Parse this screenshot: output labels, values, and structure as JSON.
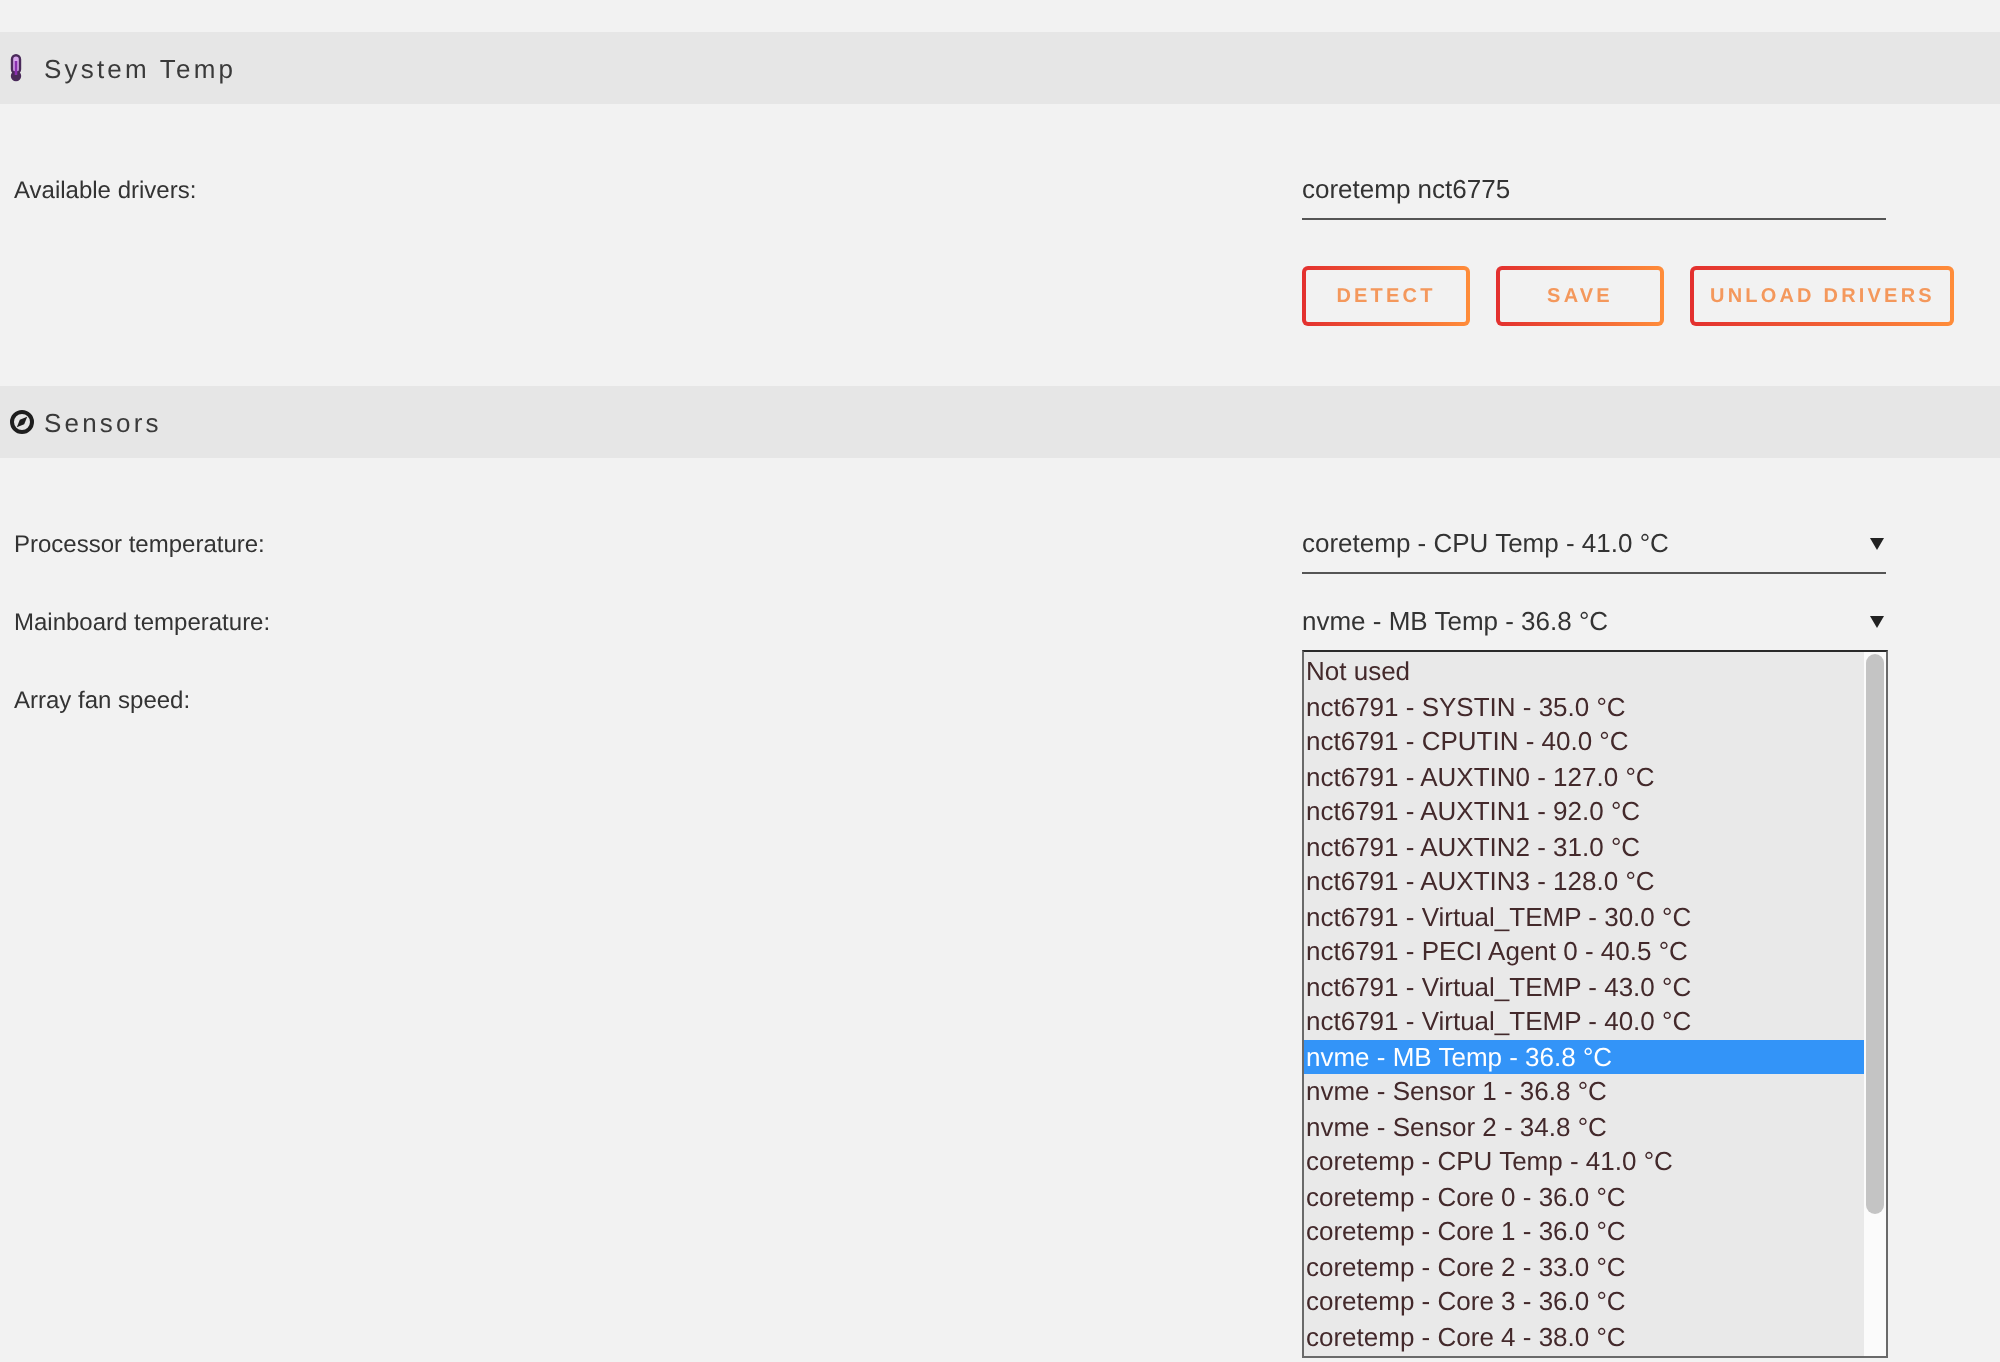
{
  "system_temp": {
    "title": "System Temp",
    "drivers": {
      "label": "Available drivers:",
      "value": "coretemp nct6775"
    },
    "buttons": [
      "DETECT",
      "SAVE",
      "UNLOAD DRIVERS"
    ]
  },
  "sensors": {
    "title": "Sensors",
    "rows": [
      {
        "label": "Processor temperature:",
        "value": "coretemp - CPU Temp - 41.0 °C",
        "expanded": false
      },
      {
        "label": "Mainboard temperature:",
        "value": "nvme - MB Temp - 36.8 °C",
        "expanded": true,
        "options": [
          {
            "label": "Not used",
            "selected": false
          },
          {
            "label": "nct6791 - SYSTIN - 35.0 °C",
            "selected": false
          },
          {
            "label": "nct6791 - CPUTIN - 40.0 °C",
            "selected": false
          },
          {
            "label": "nct6791 - AUXTIN0 - 127.0 °C",
            "selected": false
          },
          {
            "label": "nct6791 - AUXTIN1 - 92.0 °C",
            "selected": false
          },
          {
            "label": "nct6791 - AUXTIN2 - 31.0 °C",
            "selected": false
          },
          {
            "label": "nct6791 - AUXTIN3 - 128.0 °C",
            "selected": false
          },
          {
            "label": "nct6791 - Virtual_TEMP - 30.0 °C",
            "selected": false
          },
          {
            "label": "nct6791 - PECI Agent 0 - 40.5 °C",
            "selected": false
          },
          {
            "label": "nct6791 - Virtual_TEMP - 43.0 °C",
            "selected": false
          },
          {
            "label": "nct6791 - Virtual_TEMP - 40.0 °C",
            "selected": false
          },
          {
            "label": "nvme - MB Temp - 36.8 °C",
            "selected": true
          },
          {
            "label": "nvme - Sensor 1 - 36.8 °C",
            "selected": false
          },
          {
            "label": "nvme - Sensor 2 - 34.8 °C",
            "selected": false
          },
          {
            "label": "coretemp - CPU Temp - 41.0 °C",
            "selected": false
          },
          {
            "label": "coretemp - Core 0 - 36.0 °C",
            "selected": false
          },
          {
            "label": "coretemp - Core 1 - 36.0 °C",
            "selected": false
          },
          {
            "label": "coretemp - Core 2 - 33.0 °C",
            "selected": false
          },
          {
            "label": "coretemp - Core 3 - 36.0 °C",
            "selected": false
          },
          {
            "label": "coretemp - Core 4 - 38.0 °C",
            "selected": false
          }
        ]
      },
      {
        "label": "Array fan speed:"
      }
    ]
  }
}
